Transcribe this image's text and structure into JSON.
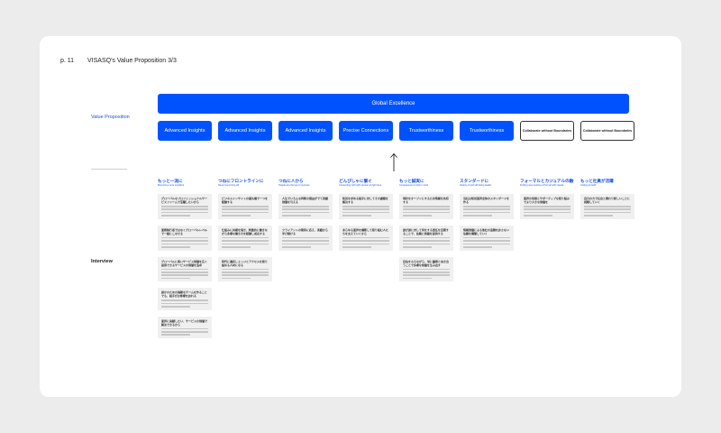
{
  "header": {
    "page": "p. 11",
    "title": "VISASQ's Value Proposition 3/3"
  },
  "labels": {
    "value_proposition": "Value Proposition",
    "interview": "Interview"
  },
  "global_excellence": "Global Excellence",
  "value_boxes": [
    {
      "label": "Advanced Insights",
      "style": "filled"
    },
    {
      "label": "Advanced Insights",
      "style": "filled"
    },
    {
      "label": "Advanced Insights",
      "style": "filled"
    },
    {
      "label": "Precise Connections",
      "style": "filled"
    },
    {
      "label": "Trustworthiness",
      "style": "filled"
    },
    {
      "label": "Trustworthiness",
      "style": "filled"
    },
    {
      "label": "Collaborate without Boundaries",
      "style": "outline"
    },
    {
      "label": "Collaborate without Boundaries",
      "style": "outline"
    }
  ],
  "columns": [
    {
      "jp": "もっと一流に",
      "en": "Becoming more excellent",
      "cards": [
        {
          "title": "グローバルなプロフェッショナルサービスファームで活躍したいから",
          "lines": 4
        },
        {
          "title": "業務執行者ではなくグローバルレベルで一緒にこなせる",
          "lines": 4
        },
        {
          "title": "グローバルに高いサービス価値を広く提供できるサービスの価値を追求",
          "lines": 4
        },
        {
          "title": "誰かのための強靭なチームを作ることでも、相手がお客様を訪れる",
          "lines": 3
        },
        {
          "title": "業界に貢献したい、サービスの価値で解決できるから",
          "lines": 3
        }
      ]
    },
    {
      "jp": "つねにフロントラインに",
      "en": "Never becoming old",
      "cards": [
        {
          "title": "ビジネスインサイトの最先端で一つを経験する",
          "lines": 4
        },
        {
          "title": "仕組みに共感を抱き、刺激的に働きながら多様な働き方を経験し成長する",
          "lines": 4
        },
        {
          "title": "時代に適応しエッジとアクセスを取り組める人材になる",
          "lines": 4
        }
      ]
    },
    {
      "jp": "つねに人から",
      "en": "People are the key to success",
      "cards": [
        {
          "title": "人生でいろんな判断の理由がでて実績価値を与える",
          "lines": 4
        },
        {
          "title": "クライアントの期待に応え、実績から学び続ける",
          "lines": 4
        }
      ]
    },
    {
      "jp": "どんぴしゃに繋ぐ",
      "en": "Connecting with right person at right time",
      "cards": [
        {
          "title": "知見を求める相手に対してその課題を解決する",
          "lines": 4
        },
        {
          "title": "あらゆる業界を横断して取り組む人たちを支えていくから",
          "lines": 4
        }
      ]
    },
    {
      "jp": "もっと誠実に",
      "en": "Competence to inform mind",
      "cards": [
        {
          "title": "現状をオープンにするため情報を共有する",
          "lines": 4
        },
        {
          "title": "誰が誰に対して何をする責任を自覚することで、信頼と価値を提供する",
          "lines": 4
        },
        {
          "title": "自信をもちながら、常に顧客と向き合うことで多様な価値を生み出す",
          "lines": 4
        }
      ]
    },
    {
      "jp": "スタンダードに",
      "en": "Variety of and still doing leader",
      "cards": [
        {
          "title": "当社は知見業界全体のスタンダードを作る",
          "lines": 4
        },
        {
          "title": "情報価値による他社の追随を許さない信頼を構築していく",
          "lines": 4
        }
      ]
    },
    {
      "jp": "フォーマルとカジュアルの融合",
      "en": "Finding new touches of formal with casual",
      "cards": [
        {
          "title": "業界の垣根とサポーティブな取り組みでより大きな価値を",
          "lines": 4
        }
      ]
    },
    {
      "jp": "もっと社員が活躍",
      "en": "Uniting all staff",
      "cards": [
        {
          "title": "自分の力で社会と関わり新しいことに挑戦していく",
          "lines": 4
        }
      ]
    }
  ]
}
